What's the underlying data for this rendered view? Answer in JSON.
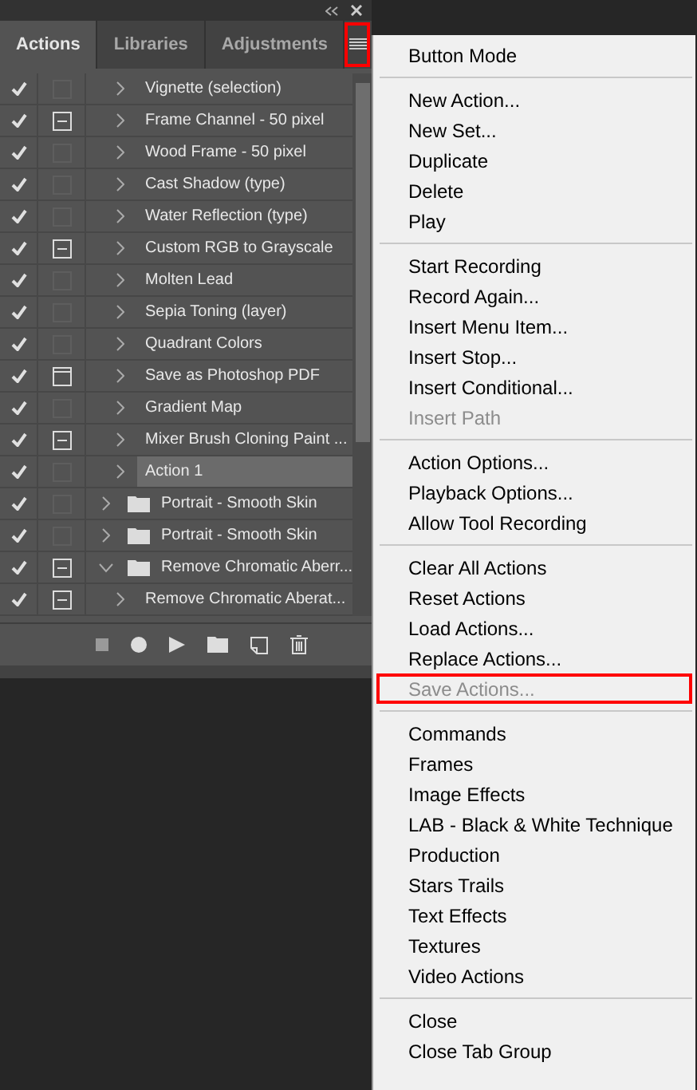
{
  "panel": {
    "tabs": [
      {
        "label": "Actions",
        "selected": true
      },
      {
        "label": "Libraries",
        "selected": false
      },
      {
        "label": "Adjustments",
        "selected": false
      }
    ],
    "menu_button": {
      "highlighted": true
    },
    "rows": [
      {
        "kind": "action",
        "checked": true,
        "dialog": false,
        "dialog_partial": false,
        "name": "Vignette (selection)",
        "selected": false,
        "expanded": false
      },
      {
        "kind": "action",
        "checked": true,
        "dialog": true,
        "dialog_partial": false,
        "name": "Frame Channel - 50 pixel",
        "selected": false,
        "expanded": false
      },
      {
        "kind": "action",
        "checked": true,
        "dialog": false,
        "dialog_partial": false,
        "name": "Wood Frame - 50 pixel",
        "selected": false,
        "expanded": false
      },
      {
        "kind": "action",
        "checked": true,
        "dialog": false,
        "dialog_partial": false,
        "name": "Cast Shadow (type)",
        "selected": false,
        "expanded": false
      },
      {
        "kind": "action",
        "checked": true,
        "dialog": false,
        "dialog_partial": false,
        "name": "Water Reflection (type)",
        "selected": false,
        "expanded": false
      },
      {
        "kind": "action",
        "checked": true,
        "dialog": true,
        "dialog_partial": false,
        "name": "Custom RGB to Grayscale",
        "selected": false,
        "expanded": false
      },
      {
        "kind": "action",
        "checked": true,
        "dialog": false,
        "dialog_partial": false,
        "name": "Molten Lead",
        "selected": false,
        "expanded": false
      },
      {
        "kind": "action",
        "checked": true,
        "dialog": false,
        "dialog_partial": false,
        "name": "Sepia Toning (layer)",
        "selected": false,
        "expanded": false
      },
      {
        "kind": "action",
        "checked": true,
        "dialog": false,
        "dialog_partial": false,
        "name": "Quadrant Colors",
        "selected": false,
        "expanded": false
      },
      {
        "kind": "action",
        "checked": true,
        "dialog": true,
        "dialog_partial": true,
        "name": "Save as Photoshop PDF",
        "selected": false,
        "expanded": false
      },
      {
        "kind": "action",
        "checked": true,
        "dialog": false,
        "dialog_partial": false,
        "name": "Gradient Map",
        "selected": false,
        "expanded": false
      },
      {
        "kind": "action",
        "checked": true,
        "dialog": true,
        "dialog_partial": false,
        "name": "Mixer Brush Cloning Paint ...",
        "selected": false,
        "expanded": false
      },
      {
        "kind": "action",
        "checked": true,
        "dialog": false,
        "dialog_partial": false,
        "name": "Action 1",
        "selected": true,
        "expanded": false
      },
      {
        "kind": "set",
        "checked": true,
        "dialog": false,
        "dialog_partial": false,
        "name": "Portrait - Smooth Skin",
        "selected": false,
        "expanded": false
      },
      {
        "kind": "set",
        "checked": true,
        "dialog": false,
        "dialog_partial": false,
        "name": "Portrait - Smooth Skin",
        "selected": false,
        "expanded": false
      },
      {
        "kind": "set",
        "checked": true,
        "dialog": true,
        "dialog_partial": false,
        "name": "Remove Chromatic Aberr...",
        "selected": false,
        "expanded": true
      },
      {
        "kind": "action",
        "checked": true,
        "dialog": true,
        "dialog_partial": false,
        "name": "Remove Chromatic Aberat...",
        "selected": false,
        "expanded": false
      }
    ]
  },
  "menu": [
    [
      {
        "label": "Button Mode",
        "disabled": false,
        "highlighted": false
      }
    ],
    [
      {
        "label": "New Action...",
        "disabled": false,
        "highlighted": false
      },
      {
        "label": "New Set...",
        "disabled": false,
        "highlighted": false
      },
      {
        "label": "Duplicate",
        "disabled": false,
        "highlighted": false
      },
      {
        "label": "Delete",
        "disabled": false,
        "highlighted": false
      },
      {
        "label": "Play",
        "disabled": false,
        "highlighted": false
      }
    ],
    [
      {
        "label": "Start Recording",
        "disabled": false,
        "highlighted": false
      },
      {
        "label": "Record Again...",
        "disabled": false,
        "highlighted": false
      },
      {
        "label": "Insert Menu Item...",
        "disabled": false,
        "highlighted": false
      },
      {
        "label": "Insert Stop...",
        "disabled": false,
        "highlighted": false
      },
      {
        "label": "Insert Conditional...",
        "disabled": false,
        "highlighted": false
      },
      {
        "label": "Insert Path",
        "disabled": true,
        "highlighted": false
      }
    ],
    [
      {
        "label": "Action Options...",
        "disabled": false,
        "highlighted": false
      },
      {
        "label": "Playback Options...",
        "disabled": false,
        "highlighted": false
      },
      {
        "label": "Allow Tool Recording",
        "disabled": false,
        "highlighted": false
      }
    ],
    [
      {
        "label": "Clear All Actions",
        "disabled": false,
        "highlighted": false
      },
      {
        "label": "Reset Actions",
        "disabled": false,
        "highlighted": false
      },
      {
        "label": "Load Actions...",
        "disabled": false,
        "highlighted": false
      },
      {
        "label": "Replace Actions...",
        "disabled": false,
        "highlighted": false
      },
      {
        "label": "Save Actions...",
        "disabled": true,
        "highlighted": true
      }
    ],
    [
      {
        "label": "Commands",
        "disabled": false,
        "highlighted": false
      },
      {
        "label": "Frames",
        "disabled": false,
        "highlighted": false
      },
      {
        "label": "Image Effects",
        "disabled": false,
        "highlighted": false
      },
      {
        "label": "LAB - Black & White Technique",
        "disabled": false,
        "highlighted": false
      },
      {
        "label": "Production",
        "disabled": false,
        "highlighted": false
      },
      {
        "label": "Stars Trails",
        "disabled": false,
        "highlighted": false
      },
      {
        "label": "Text Effects",
        "disabled": false,
        "highlighted": false
      },
      {
        "label": "Textures",
        "disabled": false,
        "highlighted": false
      },
      {
        "label": "Video Actions",
        "disabled": false,
        "highlighted": false
      }
    ],
    [
      {
        "label": "Close",
        "disabled": false,
        "highlighted": false
      },
      {
        "label": "Close Tab Group",
        "disabled": false,
        "highlighted": false
      }
    ]
  ]
}
